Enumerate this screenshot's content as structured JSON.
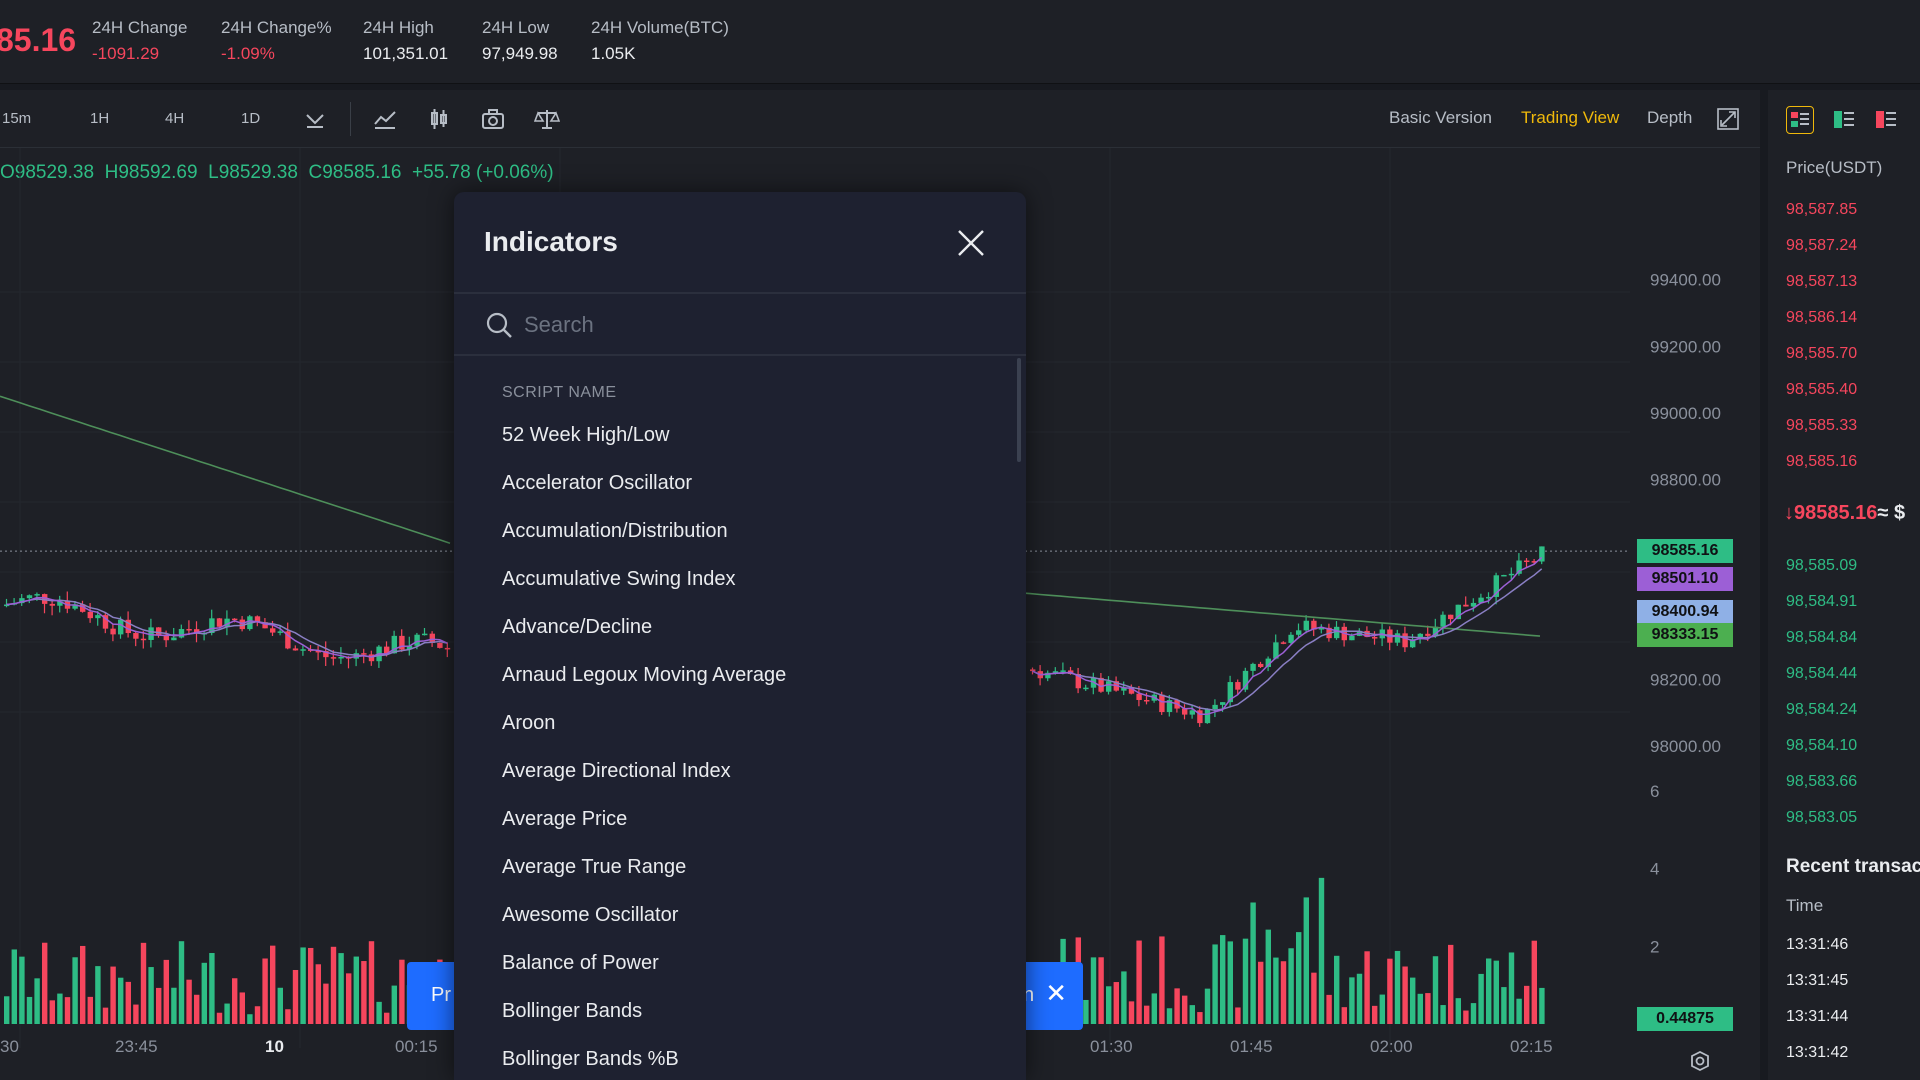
{
  "ticker": {
    "last_price": "85.16",
    "stats": [
      {
        "label": "24H Change",
        "value": "-1091.29",
        "negative": true
      },
      {
        "label": "24H Change%",
        "value": "-1.09%",
        "negative": true
      },
      {
        "label": "24H High",
        "value": "101,351.01",
        "negative": false
      },
      {
        "label": "24H Low",
        "value": "97,949.98",
        "negative": false
      },
      {
        "label": "24H Volume(BTC)",
        "value": "1.05K",
        "negative": false
      }
    ]
  },
  "toolbar": {
    "timeframes": [
      "15m",
      "1H",
      "4H",
      "1D"
    ],
    "views": {
      "basic": "Basic Version",
      "trading": "Trading View",
      "depth": "Depth"
    },
    "icons": [
      "chevron-down-icon",
      "line-chart-icon",
      "candle-icon",
      "camera-icon",
      "scale-icon",
      "fullscreen-icon"
    ]
  },
  "ohlc": {
    "open": "O98529.38",
    "high": "H98592.69",
    "low": "L98529.38",
    "close": "C98585.16",
    "change": "+55.78 (+0.06%)"
  },
  "chart_data": {
    "type": "candlestick",
    "price_axis_ticks": [
      "99400.00",
      "99200.00",
      "99000.00",
      "98800.00",
      "98200.00",
      "98000.00"
    ],
    "volume_axis_ticks": [
      "6",
      "4",
      "2"
    ],
    "time_ticks": [
      "30",
      "23:45",
      "10",
      "00:15",
      "01:30",
      "01:45",
      "02:00",
      "02:15"
    ],
    "price_range": [
      97900,
      99450
    ],
    "volume_range": [
      0,
      7
    ],
    "tags": [
      {
        "label": "98585.16",
        "value": 98585.16,
        "color": "#2ebd85"
      },
      {
        "label": "98501.10",
        "value": 98501.1,
        "color": "#9c5fd6"
      },
      {
        "label": "98400.94",
        "value": 98400.94,
        "color": "#8fb0e6"
      },
      {
        "label": "98333.15",
        "value": 98333.15,
        "color": "#4caf50"
      }
    ],
    "volume_tag": "0.44875",
    "colors": {
      "up": "#2ebd85",
      "down": "#f6465d",
      "ma_long": "#4e8f5a",
      "ma_mid": "#8a7fc4",
      "ma_short": "#9c5fd6"
    }
  },
  "orderbook": {
    "header": "Price(USDT)",
    "asks": [
      "98,587.85",
      "98,587.24",
      "98,587.13",
      "98,586.14",
      "98,585.70",
      "98,585.40",
      "98,585.33",
      "98,585.16"
    ],
    "mid_price": "↓98585.16",
    "mid_eq": "≈ $",
    "bids": [
      "98,585.09",
      "98,584.91",
      "98,584.84",
      "98,584.44",
      "98,584.24",
      "98,584.10",
      "98,583.66",
      "98,583.05"
    ],
    "recent_title": "Recent transac",
    "time_header": "Time",
    "times": [
      "13:31:46",
      "13:31:45",
      "13:31:44",
      "13:31:42"
    ]
  },
  "banner": {
    "text_left": "Pr",
    "text_right": "n"
  },
  "modal": {
    "title": "Indicators",
    "search_placeholder": "Search",
    "column_header": "SCRIPT NAME",
    "items": [
      "52 Week High/Low",
      "Accelerator Oscillator",
      "Accumulation/Distribution",
      "Accumulative Swing Index",
      "Advance/Decline",
      "Arnaud Legoux Moving Average",
      "Aroon",
      "Average Directional Index",
      "Average Price",
      "Average True Range",
      "Awesome Oscillator",
      "Balance of Power",
      "Bollinger Bands",
      "Bollinger Bands %B"
    ]
  }
}
